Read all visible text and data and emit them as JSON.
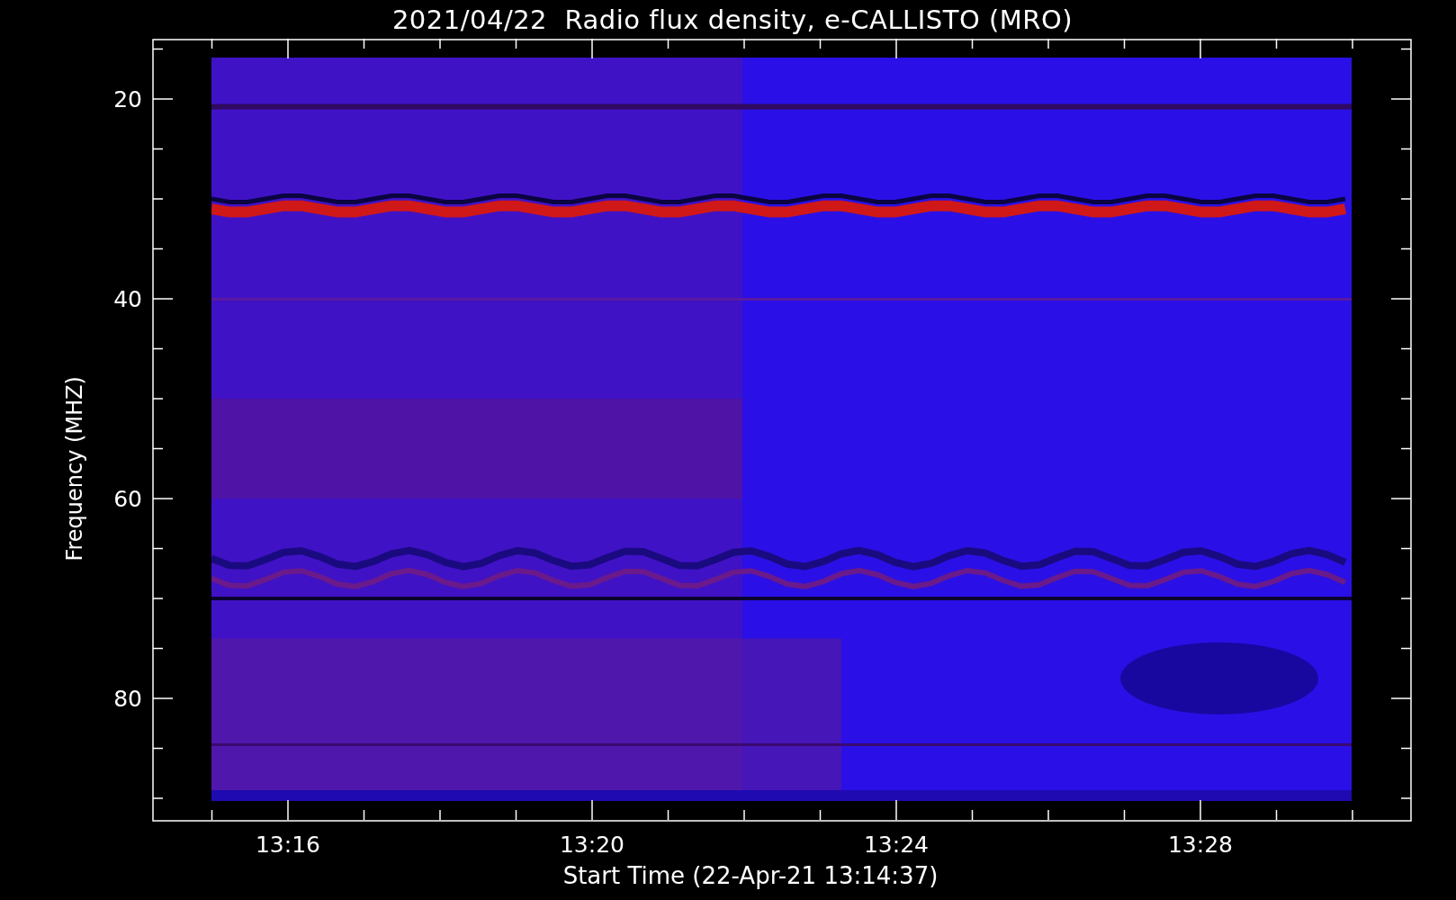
{
  "title": "2021/04/22  Radio flux density, e-CALLISTO (MRO)",
  "y_axis": {
    "label": "Frequency (MHZ)",
    "ticks": [
      "20",
      "40",
      "60",
      "80"
    ]
  },
  "x_axis": {
    "label": "Start Time (22-Apr-21 13:14:37)",
    "ticks": [
      "13:16",
      "13:20",
      "13:24",
      "13:28"
    ]
  }
}
